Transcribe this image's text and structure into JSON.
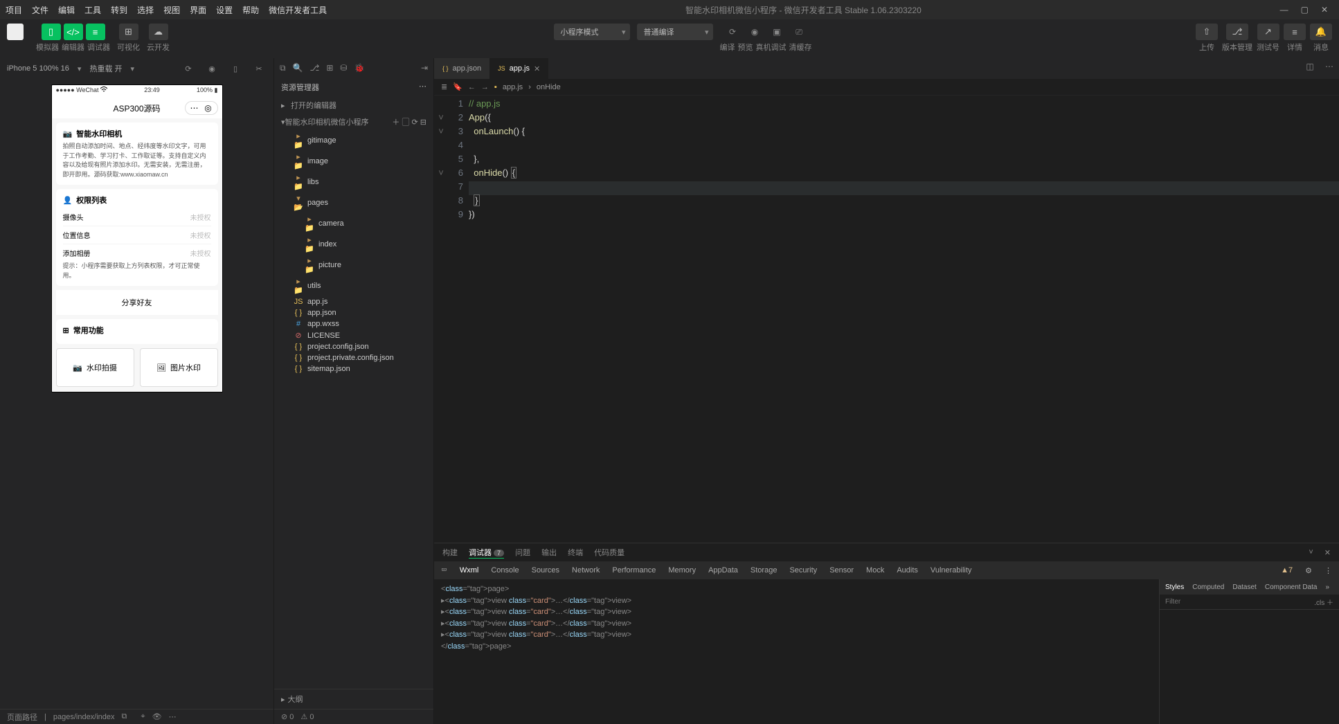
{
  "menu": [
    "项目",
    "文件",
    "编辑",
    "工具",
    "转到",
    "选择",
    "视图",
    "界面",
    "设置",
    "帮助",
    "微信开发者工具"
  ],
  "window_title": "智能水印相机微信小程序 - 微信开发者工具 Stable 1.06.2303220",
  "toolbar": {
    "sim_label": "模拟器",
    "editor_label": "编辑器",
    "debug_label": "调试器",
    "vis_label": "可视化",
    "cloud_label": "云开发",
    "mode_select": "小程序模式",
    "compile_select": "普通编译",
    "compile_label": "编译",
    "preview_label": "预览",
    "real_label": "真机调试",
    "cache_label": "清缓存",
    "upload_label": "上传",
    "version_label": "版本管理",
    "test_label": "测试号",
    "detail_label": "详情",
    "msg_label": "消息"
  },
  "sim": {
    "device": "iPhone 5 100% 16",
    "hotreload": "热重载 开",
    "status_left": "●●●●● WeChat",
    "status_time": "23:49",
    "status_right": "100%",
    "app_title": "ASP300源码",
    "intro_title": "智能水印相机",
    "intro_text": "拍照自动添加时间、地点、经纬度等水印文字，可用于工作考勤、学习打卡、工作取证等。支持自定义内容以及给现有照片添加水印。无需安装，无需注册，即开即用。源码获取:www.xiaomaw.cn",
    "perm_title": "权限列表",
    "perms": [
      {
        "name": "摄像头",
        "status": "未授权"
      },
      {
        "name": "位置信息",
        "status": "未授权"
      },
      {
        "name": "添加相册",
        "status": "未授权"
      }
    ],
    "perm_hint": "提示：小程序需要获取上方列表权限，才可正常使用。",
    "share": "分享好友",
    "func_title": "常用功能",
    "func1": "水印拍摄",
    "func2": "图片水印",
    "page_path_label": "页面路径",
    "page_path": "pages/index/index"
  },
  "explorer": {
    "title": "资源管理器",
    "open_editors": "打开的编辑器",
    "project": "智能水印相机微信小程序",
    "tree": [
      {
        "t": "folder",
        "n": "gitimage",
        "i": 0
      },
      {
        "t": "folder",
        "n": "image",
        "i": 0
      },
      {
        "t": "folder",
        "n": "libs",
        "i": 0
      },
      {
        "t": "folder",
        "n": "pages",
        "i": 0,
        "open": true
      },
      {
        "t": "folder",
        "n": "camera",
        "i": 1
      },
      {
        "t": "folder",
        "n": "index",
        "i": 1
      },
      {
        "t": "folder",
        "n": "picture",
        "i": 1
      },
      {
        "t": "folder",
        "n": "utils",
        "i": 0
      },
      {
        "t": "js",
        "n": "app.js",
        "i": 0
      },
      {
        "t": "json",
        "n": "app.json",
        "i": 0
      },
      {
        "t": "wxss",
        "n": "app.wxss",
        "i": 0
      },
      {
        "t": "lic",
        "n": "LICENSE",
        "i": 0
      },
      {
        "t": "json",
        "n": "project.config.json",
        "i": 0
      },
      {
        "t": "json",
        "n": "project.private.config.json",
        "i": 0
      },
      {
        "t": "json",
        "n": "sitemap.json",
        "i": 0
      }
    ],
    "outline": "大纲",
    "status_err": "0",
    "status_warn": "0"
  },
  "editor": {
    "tabs": [
      {
        "name": "app.json",
        "icon": "{ }"
      },
      {
        "name": "app.js",
        "icon": "JS",
        "active": true
      }
    ],
    "crumb_file": "app.js",
    "crumb_sym": "onHide",
    "lines": [
      "// app.js",
      "App({",
      "  onLaunch() {",
      "",
      "  },",
      "  onHide() {",
      "    ",
      "  }",
      "})"
    ],
    "hl_line": 7
  },
  "bottom": {
    "tabs": [
      "构建",
      "调试器",
      "问题",
      "输出",
      "终端",
      "代码质量"
    ],
    "active": "调试器",
    "badge": "7",
    "devtabs": [
      "Wxml",
      "Console",
      "Sources",
      "Network",
      "Performance",
      "Memory",
      "AppData",
      "Storage",
      "Security",
      "Sensor",
      "Mock",
      "Audits",
      "Vulnerability"
    ],
    "dev_active": "Wxml",
    "warn_count": "7",
    "styles_tabs": [
      "Styles",
      "Computed",
      "Dataset",
      "Component Data"
    ],
    "styles_active": "Styles",
    "filter_placeholder": "Filter",
    "cls": ".cls",
    "dom": [
      "<page>",
      " ▸<view class=\"card\">…</view>",
      " ▸<view class=\"card\">…</view>",
      " ▸<view class=\"card\">…</view>",
      " ▸<view class=\"card\">…</view>",
      "</page>"
    ]
  }
}
